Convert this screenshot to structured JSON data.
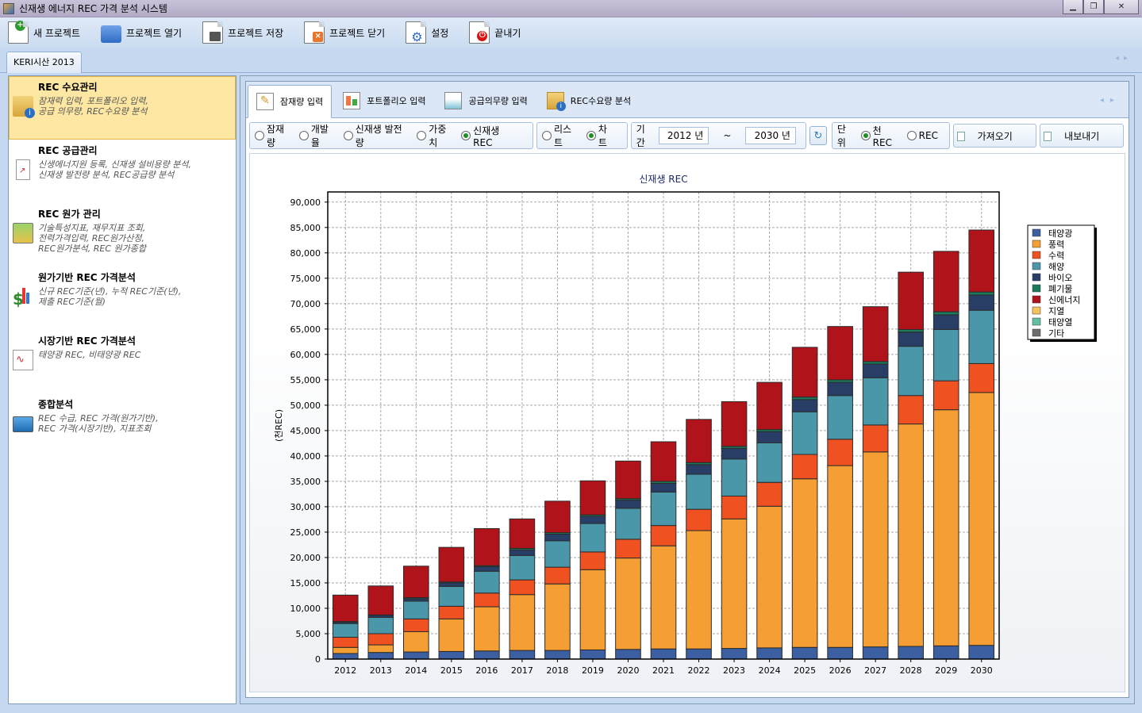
{
  "window": {
    "title": "신재생 에너지 REC 가격 분석 시스템"
  },
  "toolbar": {
    "new_project": "새 프로젝트",
    "open_project": "프로젝트 열기",
    "save_project": "프로젝트 저장",
    "close_project": "프로젝트 닫기",
    "settings": "설정",
    "exit": "끝내기"
  },
  "doc_tab": "KERI시산 2013",
  "sidebar": {
    "items": [
      {
        "title": "REC 수요관리",
        "desc": "잠재력 입력, 포트폴리오 입력,\n공급 의무량, REC수요량 분석"
      },
      {
        "title": "REC 공급관리",
        "desc": "신생에너지원 등록, 신재생 설비용량 분석,\n신재생 발전량 분석, REC공급량 분석"
      },
      {
        "title": "REC 원가 관리",
        "desc": "기술특성지표, 재무지표 조회,\n전력가격입력, REC원가산정,\nREC원가분석, REC 원가종합"
      },
      {
        "title": "원가기반 REC 가격분석",
        "desc": "신규 REC기준(년), 누적 REC기준(년),\n제출 REC기준(월)"
      },
      {
        "title": "시장기반 REC 가격분석",
        "desc": "태양광 REC, 비태양광 REC"
      },
      {
        "title": "종합분석",
        "desc": "REC 수급, REC 가격(원가기반),\nREC 가격(시장기반), 지표조회"
      }
    ]
  },
  "subtabs": [
    "잠재량 입력",
    "포트폴리오 입력",
    "공급의무량 입력",
    "REC수요량 분석"
  ],
  "options": {
    "mode": [
      "잠재량",
      "개발율",
      "신재생 발전량",
      "가중치",
      "신재생 REC"
    ],
    "view": [
      "리스트",
      "차트"
    ],
    "period_label": "기간",
    "start_year": "2012 년",
    "tilde": "~",
    "end_year": "2030 년",
    "unit_label": "단위",
    "units": [
      "천REC",
      "REC"
    ],
    "import_btn": "가져오기",
    "export_btn": "내보내기"
  },
  "colors": {
    "태양광": "#3b5fa0",
    "풍력": "#f59e34",
    "수력": "#ef5121",
    "해양": "#4b97aa",
    "바이오": "#283e66",
    "폐기물": "#1c7a5c",
    "신에너지": "#b1131b",
    "지열": "#f7c25c",
    "태양열": "#63bfa5",
    "기타": "#6d6d6d"
  },
  "chart_data": {
    "type": "bar",
    "stacked": true,
    "title": "신재생 REC",
    "ylabel": "(천REC)",
    "xlabel": "",
    "ylim": [
      0,
      92000
    ],
    "yticks": [
      0,
      5000,
      10000,
      15000,
      20000,
      25000,
      30000,
      35000,
      40000,
      45000,
      50000,
      55000,
      60000,
      65000,
      70000,
      75000,
      80000,
      85000,
      90000
    ],
    "ytick_labels": [
      "0",
      "5,000",
      "10,000",
      "15,000",
      "20,000",
      "25,000",
      "30,000",
      "35,000",
      "40,000",
      "45,000",
      "50,000",
      "55,000",
      "60,000",
      "65,000",
      "70,000",
      "75,000",
      "80,000",
      "85,000",
      "90,000"
    ],
    "grid": true,
    "legend_position": "right",
    "categories": [
      "2012",
      "2013",
      "2014",
      "2015",
      "2016",
      "2017",
      "2018",
      "2019",
      "2020",
      "2021",
      "2022",
      "2023",
      "2024",
      "2025",
      "2026",
      "2027",
      "2028",
      "2029",
      "2030"
    ],
    "series": [
      {
        "name": "태양광",
        "values": [
          1100,
          1300,
          1400,
          1500,
          1600,
          1700,
          1700,
          1800,
          1900,
          2000,
          2000,
          2100,
          2200,
          2300,
          2300,
          2400,
          2500,
          2600,
          2700
        ]
      },
      {
        "name": "풍력",
        "values": [
          1200,
          1500,
          4000,
          6400,
          8700,
          11000,
          13100,
          15800,
          18000,
          20300,
          23300,
          25500,
          27900,
          33200,
          35800,
          38400,
          43800,
          46500,
          49800
        ]
      },
      {
        "name": "수력",
        "values": [
          2000,
          2200,
          2500,
          2500,
          2700,
          2900,
          3300,
          3500,
          3700,
          4000,
          4200,
          4500,
          4700,
          4800,
          5200,
          5300,
          5600,
          5700,
          5700
        ]
      },
      {
        "name": "해양",
        "values": [
          2700,
          3200,
          3500,
          3900,
          4300,
          4800,
          5200,
          5600,
          6100,
          6600,
          6900,
          7300,
          7800,
          8400,
          8600,
          9300,
          9700,
          10100,
          10500
        ]
      },
      {
        "name": "바이오",
        "values": [
          300,
          400,
          500,
          700,
          900,
          1100,
          1300,
          1400,
          1600,
          1700,
          1900,
          2100,
          2200,
          2400,
          2600,
          2700,
          2800,
          2900,
          3000
        ]
      },
      {
        "name": "폐기물",
        "values": [
          100,
          100,
          200,
          200,
          200,
          300,
          300,
          300,
          300,
          400,
          400,
          400,
          400,
          500,
          500,
          500,
          500,
          600,
          600
        ]
      },
      {
        "name": "신에너지",
        "values": [
          5200,
          5700,
          6200,
          6800,
          7300,
          5800,
          6200,
          6700,
          7400,
          7800,
          8500,
          8800,
          9300,
          9800,
          10500,
          10800,
          11300,
          11900,
          12200
        ]
      },
      {
        "name": "지열",
        "values": [
          0,
          0,
          0,
          0,
          0,
          0,
          0,
          0,
          0,
          0,
          0,
          0,
          0,
          0,
          0,
          0,
          0,
          0,
          0
        ]
      },
      {
        "name": "태양열",
        "values": [
          0,
          0,
          0,
          0,
          0,
          0,
          0,
          0,
          0,
          0,
          0,
          0,
          0,
          0,
          0,
          0,
          0,
          0,
          0
        ]
      },
      {
        "name": "기타",
        "values": [
          0,
          0,
          0,
          0,
          0,
          0,
          0,
          0,
          0,
          0,
          0,
          0,
          0,
          0,
          0,
          0,
          0,
          0,
          0
        ]
      }
    ]
  }
}
